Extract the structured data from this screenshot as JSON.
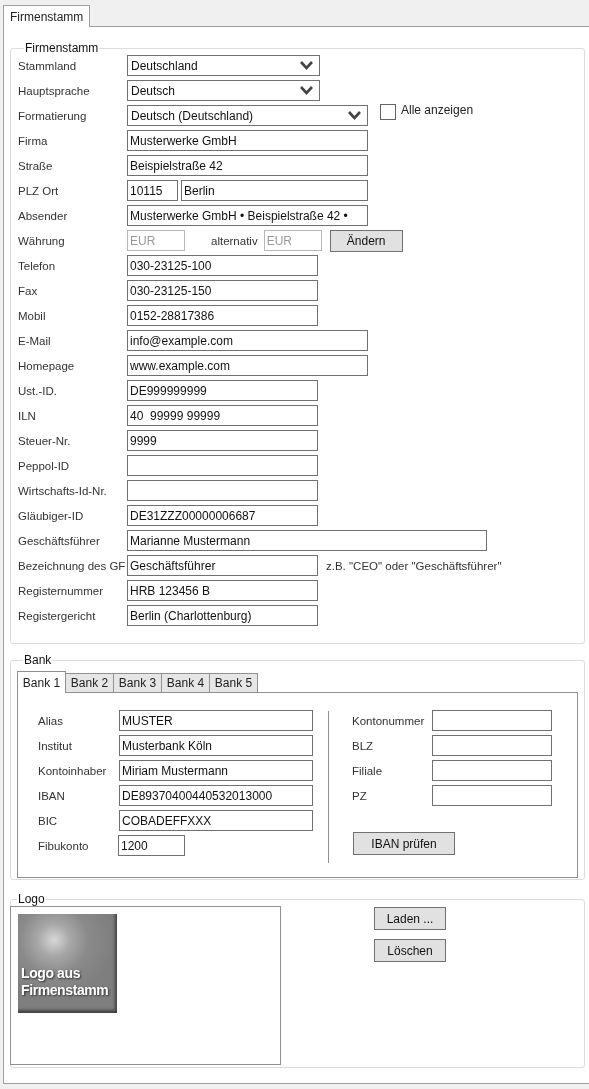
{
  "tabs": [
    {
      "label": "Firmenstamm",
      "selected": true
    }
  ],
  "firmenstamm": {
    "title": "Firmenstamm",
    "rows": [
      {
        "label": "Stammland",
        "controls": [
          {
            "kind": "select",
            "value": "Deutschland"
          }
        ]
      },
      {
        "label": "Hauptsprache",
        "controls": [
          {
            "kind": "select",
            "value": "Deutsch"
          }
        ]
      },
      {
        "label": "Formatierung",
        "controls": [
          {
            "kind": "select",
            "value": "Deutsch (Deutschland)"
          },
          {
            "kind": "checkbox",
            "label": "Alle anzeigen",
            "checked": false
          }
        ]
      },
      {
        "label": "Firma",
        "controls": [
          {
            "kind": "input",
            "value": "Musterwerke GmbH",
            "disabled": false
          }
        ]
      },
      {
        "label": "Straße",
        "controls": [
          {
            "kind": "input",
            "value": "Beispielstraße 42",
            "disabled": false
          }
        ]
      },
      {
        "label": "PLZ Ort",
        "controls": [
          {
            "kind": "input",
            "value": "10115",
            "disabled": false
          },
          {
            "kind": "input",
            "value": "Berlin",
            "disabled": false
          }
        ]
      },
      {
        "label": "Absender",
        "controls": [
          {
            "kind": "input",
            "value": "Musterwerke GmbH • Beispielstraße 42 •",
            "disabled": false
          }
        ]
      },
      {
        "label": "Währung",
        "controls": [
          {
            "kind": "input",
            "value": "EUR",
            "disabled": true
          },
          {
            "kind": "text",
            "text": "alternativ"
          },
          {
            "kind": "input",
            "value": "EUR",
            "disabled": true
          },
          {
            "kind": "button",
            "label": "Ändern"
          }
        ]
      },
      {
        "label": "Telefon",
        "controls": [
          {
            "kind": "input",
            "value": "030-23125-100",
            "disabled": false
          }
        ]
      },
      {
        "label": "Fax",
        "controls": [
          {
            "kind": "input",
            "value": "030-23125-150",
            "disabled": false
          }
        ]
      },
      {
        "label": "Mobil",
        "controls": [
          {
            "kind": "input",
            "value": "0152-28817386",
            "disabled": false
          }
        ]
      },
      {
        "label": "E-Mail",
        "controls": [
          {
            "kind": "input",
            "value": "info@example.com",
            "disabled": false
          }
        ]
      },
      {
        "label": "Homepage",
        "controls": [
          {
            "kind": "input",
            "value": "www.example.com",
            "disabled": false
          }
        ]
      },
      {
        "label": "Ust.-ID.",
        "controls": [
          {
            "kind": "input",
            "value": "DE999999999",
            "disabled": false
          }
        ]
      },
      {
        "label": "ILN",
        "controls": [
          {
            "kind": "input",
            "value": "40  99999 99999",
            "disabled": false
          }
        ]
      },
      {
        "label": "Steuer-Nr.",
        "controls": [
          {
            "kind": "input",
            "value": "9999",
            "disabled": false
          }
        ]
      },
      {
        "label": "Peppol-ID",
        "controls": [
          {
            "kind": "input",
            "disabled": false
          }
        ]
      },
      {
        "label": "Wirtschafts-Id-Nr.",
        "controls": [
          {
            "kind": "input",
            "disabled": false
          }
        ]
      },
      {
        "label": "Gläubiger-ID",
        "controls": [
          {
            "kind": "input",
            "value": "DE31ZZZ00000006687",
            "disabled": false
          }
        ]
      },
      {
        "label": "Geschäftsführer",
        "controls": [
          {
            "kind": "input",
            "value": "Marianne Mustermann",
            "disabled": false
          }
        ]
      },
      {
        "label": "Bezeichnung des GF",
        "controls": [
          {
            "kind": "input",
            "value": "Geschäftsführer",
            "disabled": false
          },
          {
            "kind": "text",
            "text": "z.B. \"CEO\" oder \"Geschäftsführer\""
          }
        ]
      },
      {
        "label": "Registernummer",
        "controls": [
          {
            "kind": "input",
            "value": "HRB 123456 B",
            "disabled": false
          }
        ]
      },
      {
        "label": "Registergericht",
        "controls": [
          {
            "kind": "input",
            "value": "Berlin (Charlottenburg)",
            "disabled": false
          }
        ]
      }
    ]
  },
  "bank": {
    "title": "Bank",
    "tabs": [
      {
        "label": "Bank 1",
        "selected": true
      },
      {
        "label": "Bank 2",
        "selected": false
      },
      {
        "label": "Bank 3",
        "selected": false
      },
      {
        "label": "Bank 4",
        "selected": false
      },
      {
        "label": "Bank 5",
        "selected": false
      }
    ],
    "left_fields": [
      {
        "label": "Alias",
        "value": "MUSTER"
      },
      {
        "label": "Institut",
        "value": "Musterbank Köln"
      },
      {
        "label": "Kontoinhaber",
        "value": "Miriam Mustermann"
      },
      {
        "label": "IBAN",
        "value": "DE89370400440532013000"
      },
      {
        "label": "BIC",
        "value": "COBADEFFXXX"
      },
      {
        "label": "Fibukonto",
        "value": "1200"
      }
    ],
    "right_fields": [
      {
        "label": "Kontonummer"
      },
      {
        "label": "BLZ"
      },
      {
        "label": "Filiale"
      },
      {
        "label": "PZ"
      }
    ],
    "button": "IBAN prüfen"
  },
  "logo": {
    "title": "Logo",
    "image_text": "Logo aus Firmenstamm",
    "buttons": [
      "Laden ...",
      "Löschen"
    ]
  }
}
